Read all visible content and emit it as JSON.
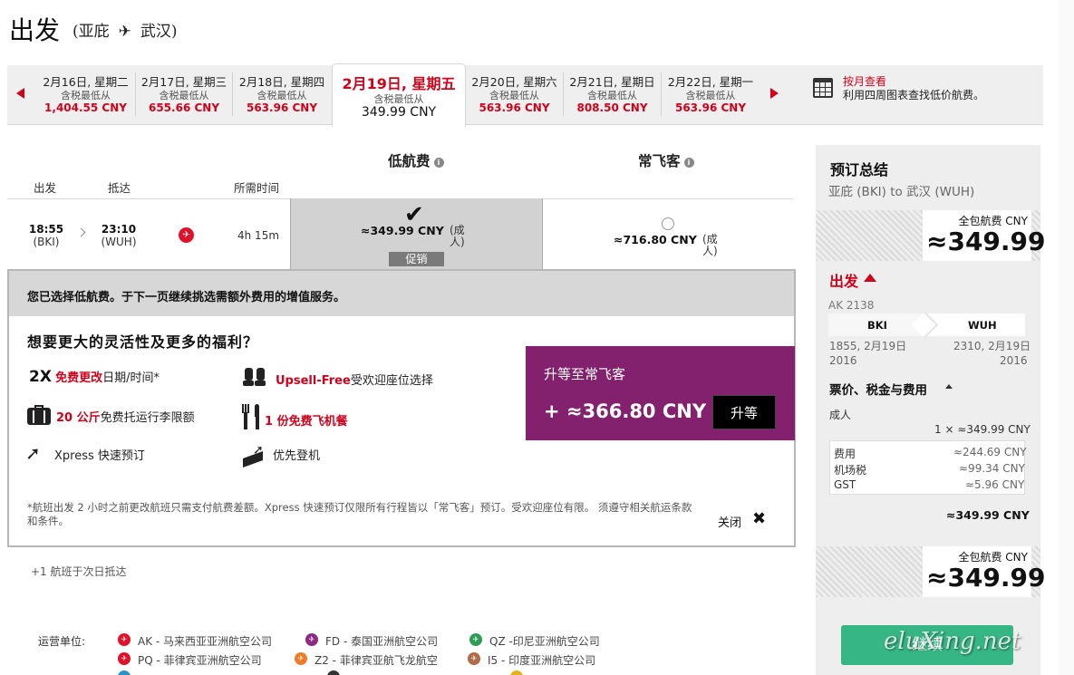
{
  "header": {
    "title": "出发",
    "origin": "(亚庇",
    "dest": "武汉)"
  },
  "dates": [
    {
      "date": "2月16日, 星期二",
      "from": "含税最低从",
      "price": "1,404.55 CNY"
    },
    {
      "date": "2月17日, 星期三",
      "from": "含税最低从",
      "price": "655.66 CNY"
    },
    {
      "date": "2月18日, 星期四",
      "from": "含税最低从",
      "price": "563.96 CNY"
    },
    {
      "date": "2月19日, 星期五",
      "from": "含税最低从",
      "price": "349.99 CNY"
    },
    {
      "date": "2月20日, 星期六",
      "from": "含税最低从",
      "price": "563.96 CNY"
    },
    {
      "date": "2月21日, 星期日",
      "from": "含税最低从",
      "price": "808.50 CNY"
    },
    {
      "date": "2月22日, 星期一",
      "from": "含税最低从",
      "price": "563.96 CNY"
    }
  ],
  "month_view": {
    "link": "按月查看",
    "desc": "利用四周图表查找低价航费。"
  },
  "fare_types": {
    "low": "低航费",
    "premium": "常飞客"
  },
  "columns": {
    "depart": "出发",
    "arrive": "抵达",
    "duration": "所需时间"
  },
  "flight": {
    "dep_time": "18:55",
    "dep_code": "(BKI)",
    "arr_time": "23:10",
    "arr_code": "(WUH)",
    "duration": "4h 15m",
    "low_fare": "≈349.99 CNY",
    "low_pax": "(成人)",
    "promo": "促销",
    "premium_fare": "≈716.80 CNY",
    "premium_pax": "(成人)"
  },
  "upsell": {
    "notice": "您已选择低航费。于下一页继续挑选需额外费用的增值服务。",
    "question": "想要更大的灵活性及更多的福利？",
    "f1_big": "2X",
    "f1_red": "免费更改",
    "f1_text": "日期/时间*",
    "f2_red": "Upsell-Free",
    "f2_text": "受欢迎座位选择",
    "f3_red": "20 公斤",
    "f3_text": "免费托运行李限额",
    "f4_red": "1 份免费飞机餐",
    "f5_text": "Xpress 快速预订",
    "f6_text": "优先登机",
    "upgrade_label": "升等至常飞客",
    "upgrade_price": "+ ≈366.80 CNY",
    "upgrade_button": "升等",
    "footnote": "*航班出发 2 小时之前更改航班只需支付航费差额。Xpress 快速预订仅限所有行程皆以「常飞客」预订。受欢迎座位有限。 须遵守相关航运条款和条件。",
    "close": "关闭"
  },
  "next_day_note": "+1 航班于次日抵达",
  "operators": {
    "label": "运营单位:",
    "items": [
      {
        "text": "AK - 马来西亚亚洲航空公司",
        "color": "#e0112b"
      },
      {
        "text": "FD - 泰国亚洲航空公司",
        "color": "#8e2a86"
      },
      {
        "text": "QZ -印尼亚洲航空公司",
        "color": "#2e9b56"
      },
      {
        "text": "PQ - 菲律宾亚洲航空公司",
        "color": "#e0112b"
      },
      {
        "text": "Z2 - 菲律宾亚航飞龙航空",
        "color": "#f07c2a"
      },
      {
        "text": "I5 - 印度亚洲航空公司",
        "color": "#b06b48"
      }
    ]
  },
  "summary": {
    "title": "预订总结",
    "route": "亚庇 (BKI) to 武汉 (WUH)",
    "total_label": "全包航费 CNY",
    "total_value": "≈349.99",
    "outbound": "出发",
    "flight_no": "AK 2138",
    "leg_from": "BKI",
    "leg_to": "WUH",
    "dep_dt": "1855, 2月19日",
    "dep_year": "2016",
    "arr_dt": "2310, 2月19日",
    "arr_year": "2016",
    "fees_title": "票价、税金与费用",
    "adult": "成人",
    "adult_line": "1 × ≈349.99 CNY",
    "fees": [
      {
        "label": "费用",
        "value": "≈244.69 CNY"
      },
      {
        "label": "机场税",
        "value": "≈99.34 CNY"
      },
      {
        "label": "GST",
        "value": "≈5.96 CNY"
      }
    ],
    "subtotal": "≈349.99 CNY",
    "continue": "继续"
  },
  "watermark": "eluXing.net",
  "colors": {
    "brand_red": "#d0021b",
    "upsell_purple": "#83216e",
    "continue_green": "#36b585"
  }
}
